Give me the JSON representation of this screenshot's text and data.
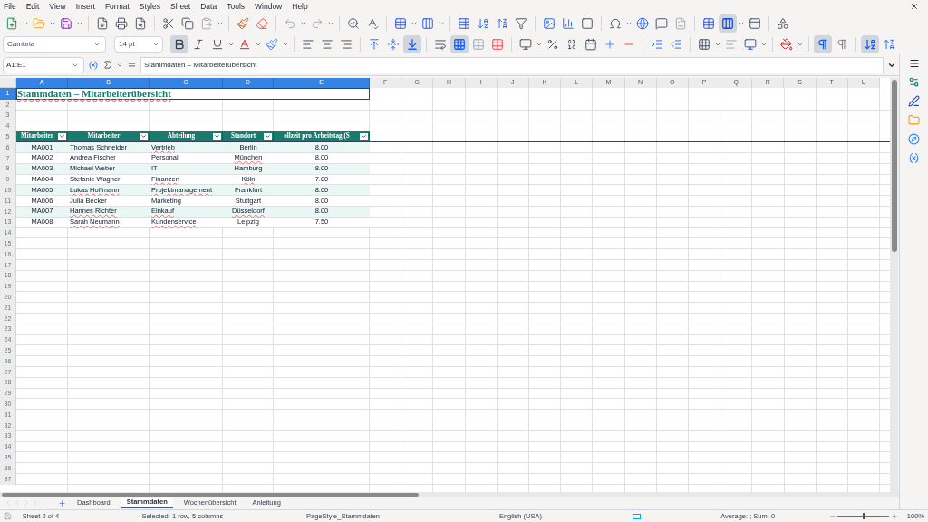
{
  "menu": [
    "File",
    "Edit",
    "View",
    "Insert",
    "Format",
    "Styles",
    "Sheet",
    "Data",
    "Tools",
    "Window",
    "Help"
  ],
  "format_toolbar": {
    "font": "Cambria",
    "size": "14 pt",
    "bold": true,
    "italic": false,
    "underline": false,
    "align_bottom": true,
    "merge_center": true,
    "left_to_right": true,
    "stacked_text": true
  },
  "standard_toolbar": {
    "freeze_pressed": true
  },
  "formula_bar": {
    "name_box": "A1:E1",
    "content": "Stammdaten – Mitarbeiterübersicht"
  },
  "columns": [
    {
      "label": "A",
      "selected": true
    },
    {
      "label": "B",
      "selected": true
    },
    {
      "label": "C",
      "selected": true
    },
    {
      "label": "D",
      "selected": true
    },
    {
      "label": "E",
      "selected": true
    },
    {
      "label": "F",
      "selected": false
    },
    {
      "label": "G",
      "selected": false
    },
    {
      "label": "H",
      "selected": false
    },
    {
      "label": "I",
      "selected": false
    },
    {
      "label": "J",
      "selected": false
    },
    {
      "label": "K",
      "selected": false
    },
    {
      "label": "L",
      "selected": false
    },
    {
      "label": "M",
      "selected": false
    },
    {
      "label": "N",
      "selected": false
    },
    {
      "label": "O",
      "selected": false
    },
    {
      "label": "P",
      "selected": false
    },
    {
      "label": "Q",
      "selected": false
    },
    {
      "label": "R",
      "selected": false
    },
    {
      "label": "S",
      "selected": false
    },
    {
      "label": "T",
      "selected": false
    },
    {
      "label": "U",
      "selected": false
    }
  ],
  "title": {
    "text": "Stammdaten – Mitarbeiterübersicht",
    "misspelled": true
  },
  "headers": [
    "Mitarbeiter",
    "Mitarbeiter",
    "Abteilung",
    "Standort",
    "ollzeit pro Arbeitstag (S"
  ],
  "data_rows": [
    [
      {
        "text": "MA001",
        "misspelled": false
      },
      {
        "text": "Thomas Schneider",
        "misspelled": false
      },
      {
        "text": "Vertrieb",
        "misspelled": true
      },
      {
        "text": "Berlin",
        "misspelled": false
      },
      {
        "text": "8.00",
        "misspelled": false
      }
    ],
    [
      {
        "text": "MA002",
        "misspelled": false
      },
      {
        "text": "Andrea Fischer",
        "misspelled": false
      },
      {
        "text": "Personal",
        "misspelled": false
      },
      {
        "text": "München",
        "misspelled": true
      },
      {
        "text": "8.00",
        "misspelled": false
      }
    ],
    [
      {
        "text": "MA003",
        "misspelled": false
      },
      {
        "text": "Michael Weber",
        "misspelled": false
      },
      {
        "text": "IT",
        "misspelled": false
      },
      {
        "text": "Hamburg",
        "misspelled": false
      },
      {
        "text": "8.00",
        "misspelled": false
      }
    ],
    [
      {
        "text": "MA004",
        "misspelled": false
      },
      {
        "text": "Stefanie Wagner",
        "misspelled": false
      },
      {
        "text": "Finanzen",
        "misspelled": true
      },
      {
        "text": "Köln",
        "misspelled": true
      },
      {
        "text": "7.80",
        "misspelled": false
      }
    ],
    [
      {
        "text": "MA005",
        "misspelled": false
      },
      {
        "text": "Lukas Hoffmann",
        "misspelled": true
      },
      {
        "text": "Projektmanagement",
        "misspelled": true
      },
      {
        "text": "Frankfurt",
        "misspelled": false
      },
      {
        "text": "8.00",
        "misspelled": false
      }
    ],
    [
      {
        "text": "MA006",
        "misspelled": false
      },
      {
        "text": "Julia Becker",
        "misspelled": false
      },
      {
        "text": "Marketing",
        "misspelled": false
      },
      {
        "text": "Stuttgart",
        "misspelled": false
      },
      {
        "text": "8.00",
        "misspelled": false
      }
    ],
    [
      {
        "text": "MA007",
        "misspelled": false
      },
      {
        "text": "Hannes Richter",
        "misspelled": true
      },
      {
        "text": "Einkauf",
        "misspelled": true
      },
      {
        "text": "Düsseldorf",
        "misspelled": true
      },
      {
        "text": "8.00",
        "misspelled": false
      }
    ],
    [
      {
        "text": "MA008",
        "misspelled": false
      },
      {
        "text": "Sarah Neumann",
        "misspelled": true
      },
      {
        "text": "Kundenservice",
        "misspelled": true
      },
      {
        "text": "Leipzig",
        "misspelled": false
      },
      {
        "text": "7.50",
        "misspelled": false
      }
    ]
  ],
  "rows": [
    {
      "label": "1",
      "selected": true
    },
    {
      "label": "2",
      "selected": false
    },
    {
      "label": "3",
      "selected": false
    },
    {
      "label": "4",
      "selected": false
    },
    {
      "label": "5",
      "selected": false
    },
    {
      "label": "6",
      "selected": false
    },
    {
      "label": "7",
      "selected": false
    },
    {
      "label": "8",
      "selected": false
    },
    {
      "label": "9",
      "selected": false
    },
    {
      "label": "10",
      "selected": false
    },
    {
      "label": "11",
      "selected": false
    },
    {
      "label": "12",
      "selected": false
    },
    {
      "label": "13",
      "selected": false
    },
    {
      "label": "14",
      "selected": false
    },
    {
      "label": "15",
      "selected": false
    },
    {
      "label": "16",
      "selected": false
    },
    {
      "label": "17",
      "selected": false
    },
    {
      "label": "18",
      "selected": false
    },
    {
      "label": "19",
      "selected": false
    },
    {
      "label": "20",
      "selected": false
    },
    {
      "label": "21",
      "selected": false
    },
    {
      "label": "22",
      "selected": false
    },
    {
      "label": "23",
      "selected": false
    },
    {
      "label": "24",
      "selected": false
    },
    {
      "label": "25",
      "selected": false
    },
    {
      "label": "26",
      "selected": false
    },
    {
      "label": "27",
      "selected": false
    },
    {
      "label": "28",
      "selected": false
    },
    {
      "label": "29",
      "selected": false
    },
    {
      "label": "30",
      "selected": false
    },
    {
      "label": "31",
      "selected": false
    },
    {
      "label": "32",
      "selected": false
    },
    {
      "label": "33",
      "selected": false
    },
    {
      "label": "34",
      "selected": false
    },
    {
      "label": "35",
      "selected": false
    },
    {
      "label": "36",
      "selected": false
    },
    {
      "label": "37",
      "selected": false
    }
  ],
  "sheet_tabs": [
    {
      "label": "Dashboard",
      "selected": false
    },
    {
      "label": "Stammdaten",
      "selected": true
    },
    {
      "label": "Wochenübersicht",
      "selected": false
    },
    {
      "label": "Anleitung",
      "selected": false
    }
  ],
  "status_bar": {
    "sheet": "Sheet 2 of 4",
    "selection": "Selected: 1 row, 5 columns",
    "page_style": "PageStyle_Stammdaten",
    "language": "English (USA)",
    "summary": "Average: ; Sum: 0",
    "zoom_slider": {
      "level": 0.5
    },
    "zoom": "100%"
  }
}
